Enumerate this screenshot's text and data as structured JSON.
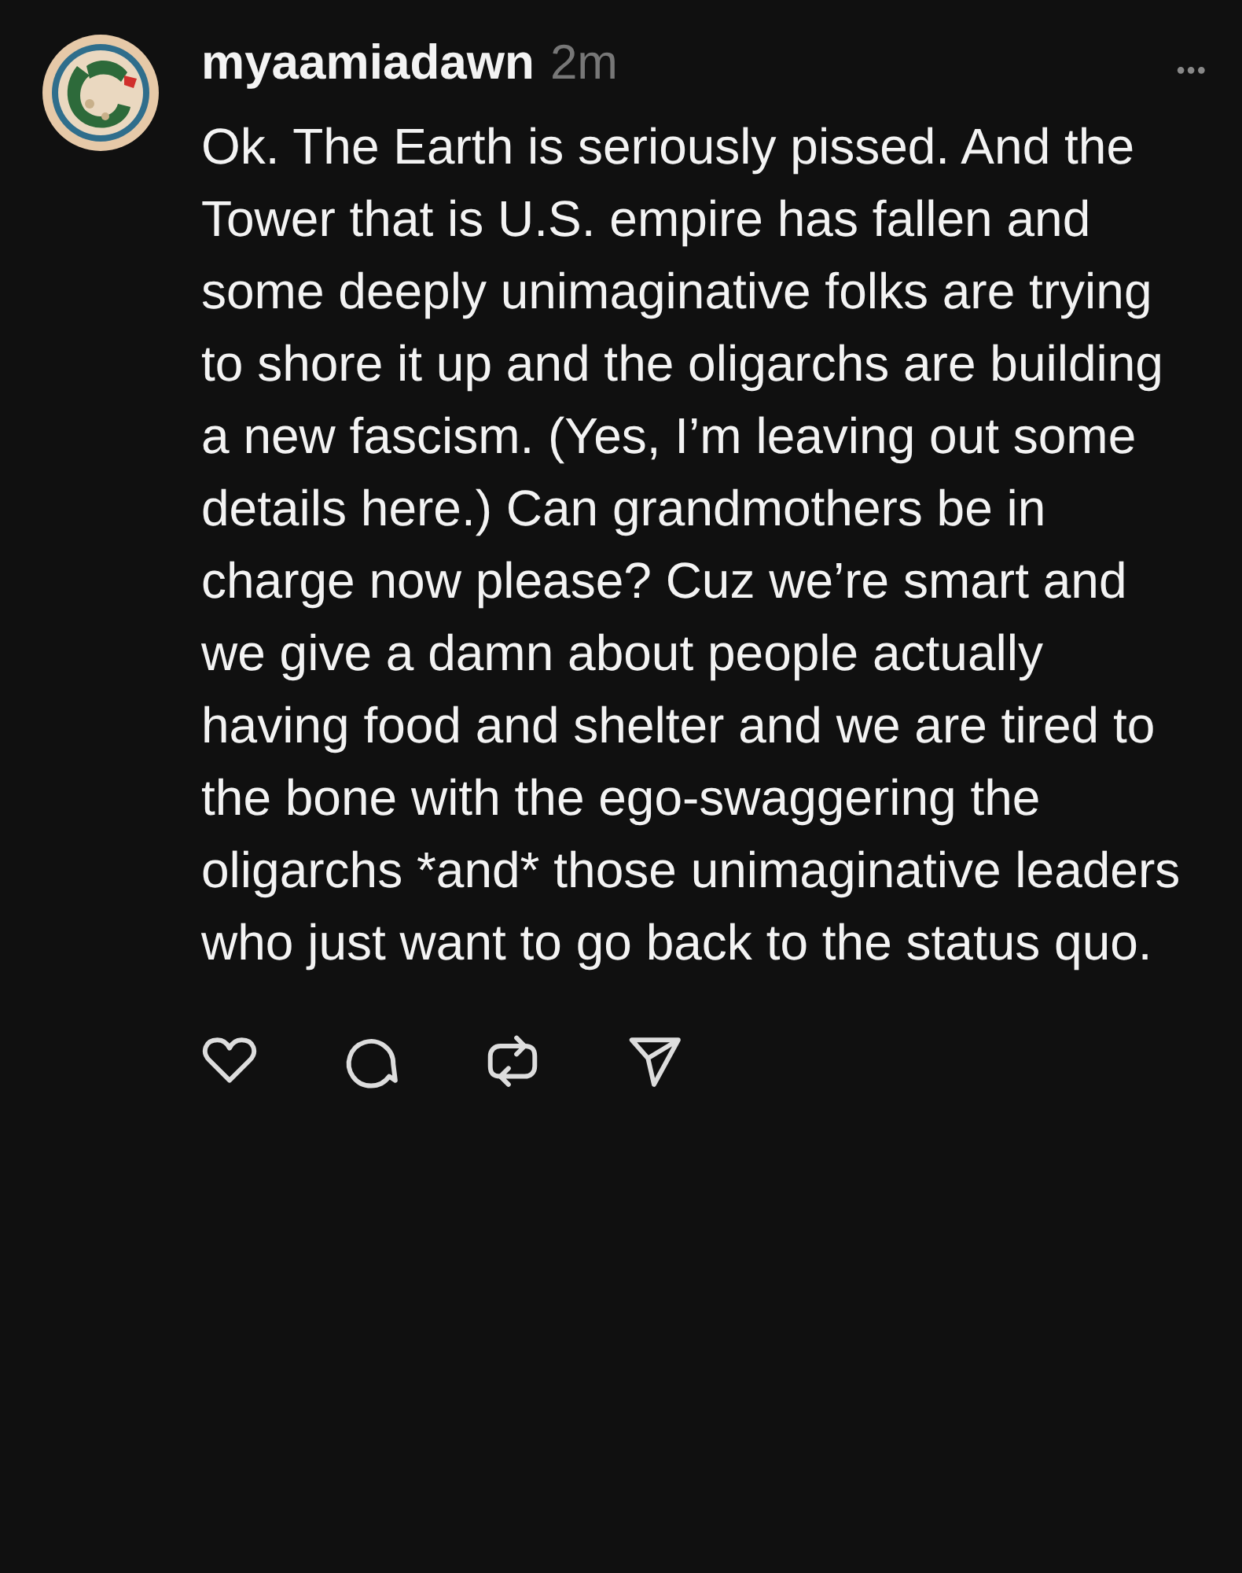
{
  "post": {
    "username": "myaamiadawn",
    "time": "2m",
    "more": "•••",
    "text": "Ok. The Earth is seriously pissed. And the Tower that is U.S. empire has fallen and some deeply unimaginative folks are trying to shore it up and the oligarchs are building a new fascism. (Yes, I’m leaving out some details here.) Can grandmothers be in charge now please? Cuz  we’re smart and we give a damn about people actually having food and shelter and we are tired to the bone with the ego-swaggering the oligarchs *and* those unimaginative leaders who just want to go back to the status quo."
  }
}
